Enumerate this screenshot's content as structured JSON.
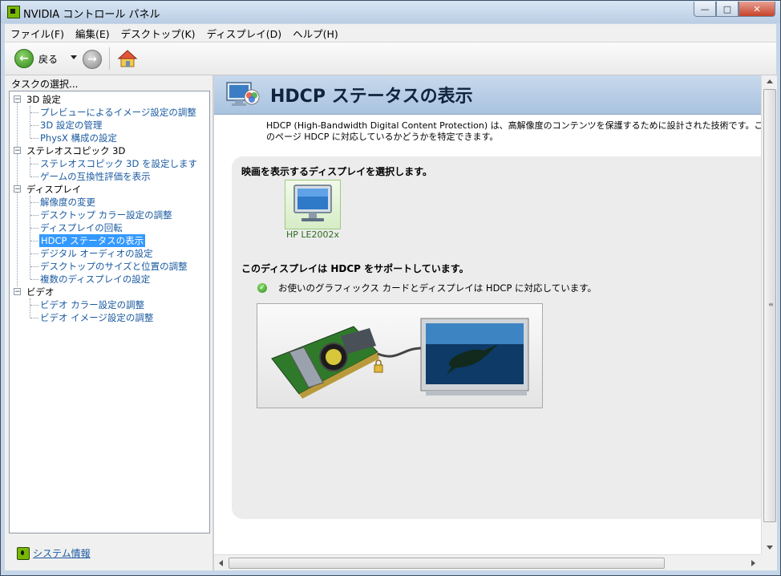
{
  "window": {
    "title": "NVIDIA コントロール パネル"
  },
  "menubar": {
    "items": [
      {
        "label": "ファイル(F)"
      },
      {
        "label": "編集(E)"
      },
      {
        "label": "デスクトップ(K)"
      },
      {
        "label": "ディスプレイ(D)"
      },
      {
        "label": "ヘルプ(H)"
      }
    ]
  },
  "toolbar": {
    "back_label": "戻る"
  },
  "left_pane": {
    "task_label": "タスクの選択...",
    "tree": [
      {
        "label": "3D 設定",
        "children": [
          {
            "label": "プレビューによるイメージ設定の調整"
          },
          {
            "label": "3D 設定の管理"
          },
          {
            "label": "PhysX 構成の設定"
          }
        ]
      },
      {
        "label": "ステレオスコピック 3D",
        "children": [
          {
            "label": "ステレオスコピック 3D を設定します"
          },
          {
            "label": "ゲームの互換性評価を表示"
          }
        ]
      },
      {
        "label": "ディスプレイ",
        "children": [
          {
            "label": "解像度の変更"
          },
          {
            "label": "デスクトップ カラー設定の調整"
          },
          {
            "label": "ディスプレイの回転"
          },
          {
            "label": "HDCP ステータスの表示",
            "selected": true
          },
          {
            "label": "デジタル オーディオの設定"
          },
          {
            "label": "デスクトップのサイズと位置の調整"
          },
          {
            "label": "複数のディスプレイの設定"
          }
        ]
      },
      {
        "label": "ビデオ",
        "children": [
          {
            "label": "ビデオ カラー設定の調整"
          },
          {
            "label": "ビデオ イメージ設定の調整"
          }
        ]
      }
    ],
    "system_info": "システム情報"
  },
  "content": {
    "title": "HDCP ステータスの表示",
    "description": "HDCP (High-Bandwidth Digital Content Protection) は、高解像度のコンテンツを保護するために設計された技術です。このページ HDCP に対応しているかどうかを特定できます。",
    "select_display_label": "映画を表示するディスプレイを選択します。",
    "display_name": "HP LE2002x",
    "support_heading": "このディスプレイは HDCP をサポートしています。",
    "support_detail": "お使いのグラフィックス カードとディスプレイは HDCP に対応しています。"
  },
  "colors": {
    "accent_green": "#76b900",
    "link_blue": "#1a5aa0",
    "selection": "#3399ff"
  }
}
